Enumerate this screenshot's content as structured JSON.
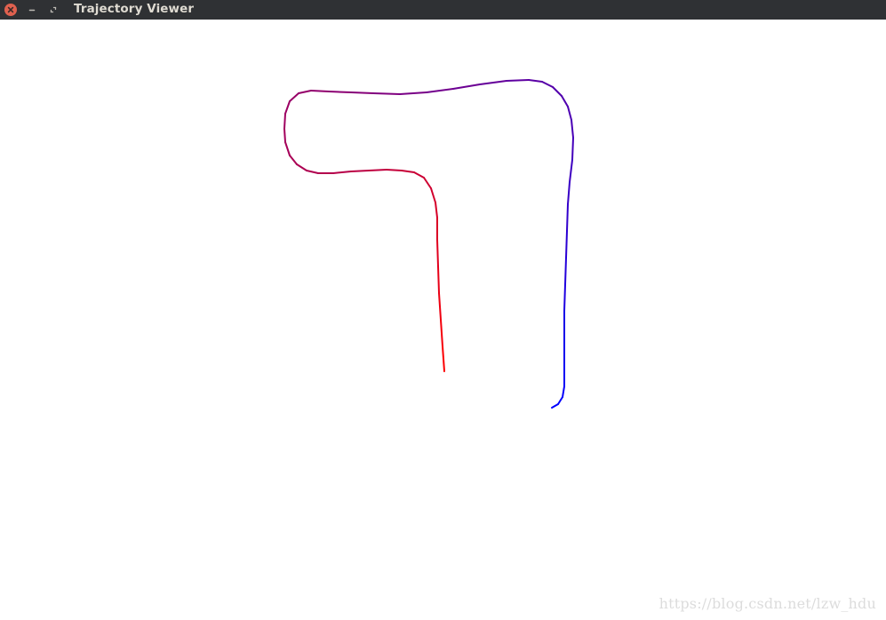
{
  "window": {
    "title": "Trajectory Viewer"
  },
  "titlebar": {
    "buttons": [
      {
        "name": "close",
        "icon": "close-icon",
        "color": "#e0614f"
      },
      {
        "name": "minimize",
        "icon": "minimize-icon"
      },
      {
        "name": "maximize",
        "icon": "maximize-icon"
      }
    ]
  },
  "trajectory": {
    "start_color": "#ff0000",
    "end_color": "#0000ff",
    "description_points": "trajectory path from red start to blue end"
  },
  "watermark": {
    "text": "https://blog.csdn.net/lzw_hdu"
  }
}
